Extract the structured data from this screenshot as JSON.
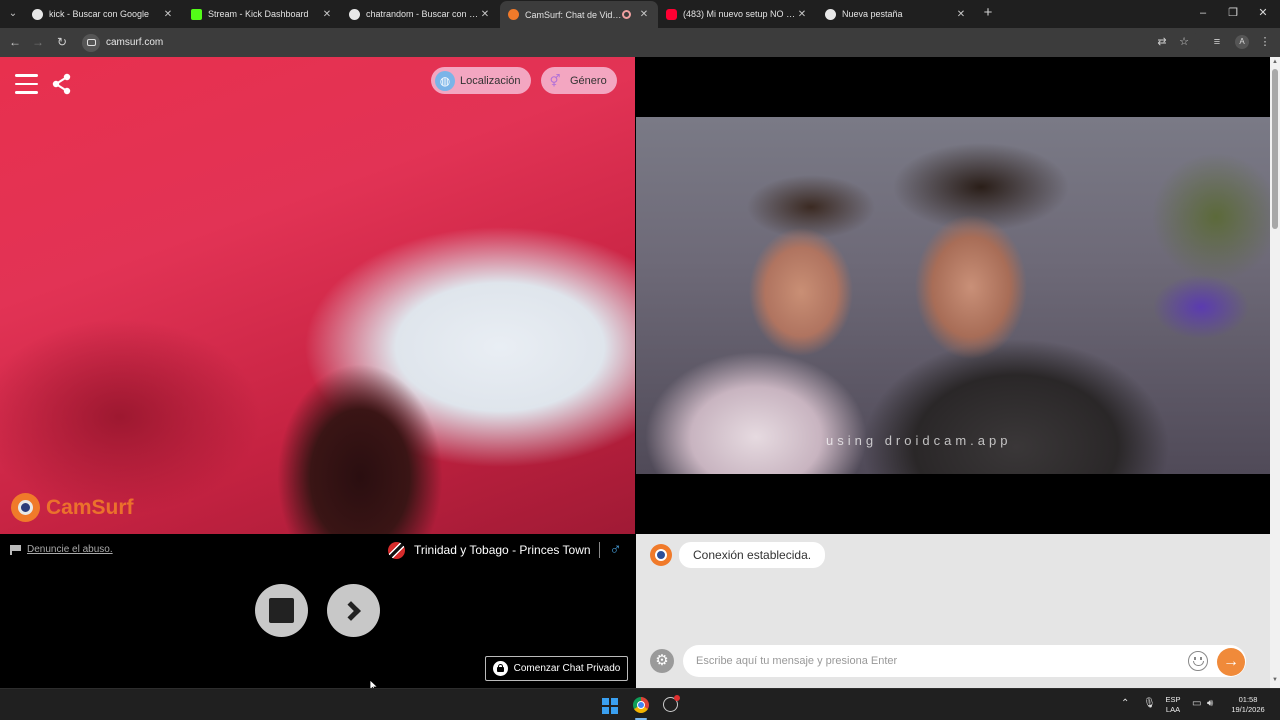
{
  "browser": {
    "tabs": [
      {
        "title": "kick - Buscar con Google",
        "favicon_color": "#e8e8e8",
        "active": false
      },
      {
        "title": "Stream - Kick Dashboard",
        "favicon_color": "#53fc18",
        "active": false
      },
      {
        "title": "chatrandom - Buscar con Google",
        "favicon_color": "#e8e8e8",
        "active": false
      },
      {
        "title": "CamSurf: Chat de Video Ale",
        "favicon_color": "#f07a2a",
        "active": true
      },
      {
        "title": "(483) Mi nuevo setup NO SE VI",
        "favicon_color": "#ff0033",
        "active": false
      },
      {
        "title": "Nueva pestaña",
        "favicon_color": "#e8e8e8",
        "active": false
      }
    ],
    "url": "camsurf.com",
    "profile_initial": "A"
  },
  "page": {
    "filters": {
      "location_label": "Localización",
      "gender_label": "Género"
    },
    "brand": "CamSurf",
    "remote_watermark": "using droidcam.app",
    "report_link": "Denuncie el abuso.",
    "partner_location": "Trinidad y Tobago - Princes Town",
    "private_chat_label": "Comenzar Chat Privado",
    "chat": {
      "system_message": "Conexión establecida.",
      "input_placeholder": "Escribe aquí tu mensaje y presiona Enter"
    }
  },
  "taskbar": {
    "language_line1": "ESP",
    "language_line2": "LAA",
    "time": "01:58",
    "date": "19/1/2026"
  },
  "colors": {
    "accent_orange": "#f07a2a",
    "filter_pill": "#f3a6c1",
    "male_blue": "#4aa8e8"
  }
}
